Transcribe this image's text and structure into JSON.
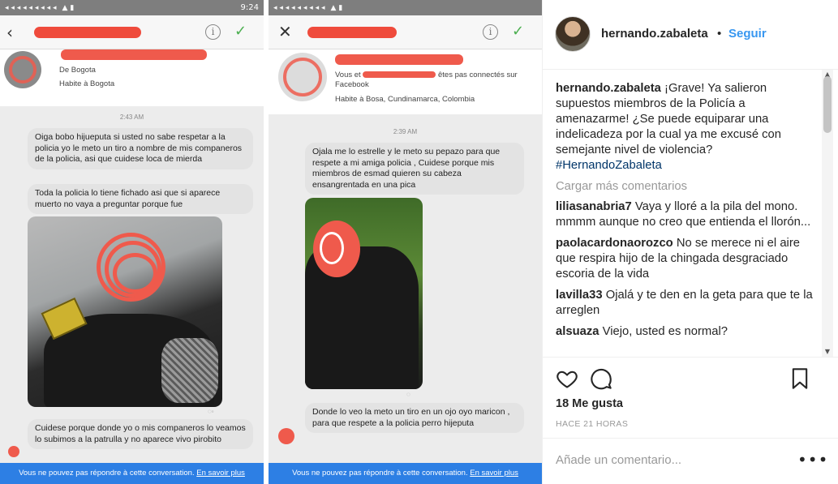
{
  "left_phone": {
    "status_time": "9:24",
    "profile_location": "De Bogota",
    "profile_habite": "Habite à Bogota",
    "timestamp": "2:43 AM",
    "messages": [
      "Oiga bobo hijueputa si usted no sabe respetar a la policia yo le meto un tiro a nombre de mis companeros de la policia, asi que cuidese loca de mierda",
      "Toda la policia lo tiene fichado asi que si aparece muerto no vaya a preguntar porque fue",
      "Cuidese porque donde yo o mis companeros lo veamos lo subimos a la patrulla y no aparece vivo pirobito"
    ],
    "footer_text": "Vous ne pouvez pas répondre à cette conversation.",
    "footer_link": "En savoir plus"
  },
  "right_phone": {
    "profile_line1": "Vous et",
    "profile_line1b": "êtes pas connectés sur",
    "profile_line2": "Facebook",
    "profile_habite": "Habite à Bosa, Cundinamarca, Colombia",
    "timestamp": "2:39 AM",
    "messages": [
      "Ojala me lo estrelle y le meto su pepazo para que respete a mi amiga policia , Cuidese porque mis miembros de esmad quieren su cabeza ensangrentada en una pica",
      "Donde lo veo la meto un tiro en un ojo oyo maricon , para que respete a la policia perro hijeputa"
    ],
    "footer_text": "Vous ne pouvez pas répondre à cette conversation.",
    "footer_link": "En savoir plus"
  },
  "instagram": {
    "username": "hernando.zabaleta",
    "separator": "•",
    "follow_label": "Seguir",
    "caption_user": "hernando.zabaleta",
    "caption_text": "¡Grave! Ya salieron supuestos miembros de la Policía a amenazarme! ¿Se puede equiparar una indelicadeza por la cual ya me excusé con semejante nivel de violencia?",
    "caption_tag": "#HernandoZabaleta",
    "load_more": "Cargar más comentarios",
    "comments": [
      {
        "user": "liliasanabria7",
        "text": "Vaya y lloré a la pila del mono. mmmm aunque no creo que entienda el llorón..."
      },
      {
        "user": "paolacardonaorozco",
        "text": "No se merece ni el aire que respira hijo de la chingada desgraciado escoria de la vida"
      },
      {
        "user": "lavilla33",
        "text": "Ojalá y te den en la geta para que te la arreglen"
      },
      {
        "user": "alsuaza",
        "text": "Viejo, usted es normal?"
      }
    ],
    "likes": "18 Me gusta",
    "time_ago": "HACE 21 HORAS",
    "add_comment_placeholder": "Añade un comentario...",
    "more_options": "•••",
    "icons": {
      "like": "heart-icon",
      "comment": "comment-icon",
      "save": "bookmark-icon"
    },
    "colors": {
      "link_blue": "#3897f0",
      "redaction_red": "#ef5a4c",
      "messenger_footer": "#2d7fe4"
    }
  }
}
